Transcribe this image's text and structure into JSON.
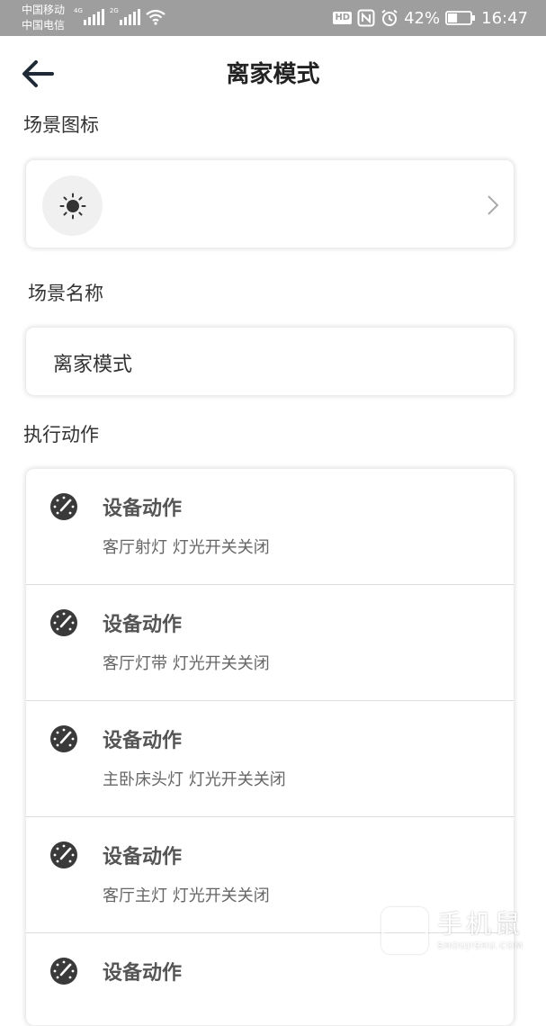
{
  "status_bar": {
    "carrier_1": "中国移动",
    "carrier_2": "中国电信",
    "net_1": "4G",
    "net_2": "2G",
    "hd": "HD",
    "battery_level": 0.42,
    "battery_text": "42%",
    "time": "16:47"
  },
  "header": {
    "title": "离家模式"
  },
  "scene_icon": {
    "label": "场景图标",
    "icon": "sun-icon"
  },
  "scene_name": {
    "label": "场景名称",
    "value": "离家模式"
  },
  "actions": {
    "label": "执行动作",
    "items": [
      {
        "title": "设备动作",
        "desc": "客厅射灯 灯光开关关闭"
      },
      {
        "title": "设备动作",
        "desc": "客厅灯带 灯光开关关闭"
      },
      {
        "title": "设备动作",
        "desc": "主卧床头灯 灯光开关关闭"
      },
      {
        "title": "设备动作",
        "desc": "客厅主灯 灯光开关关闭"
      },
      {
        "title": "设备动作",
        "desc": ""
      }
    ]
  },
  "watermark": {
    "text": "手机鼠",
    "sub": "SHOUJISHU.COM"
  }
}
